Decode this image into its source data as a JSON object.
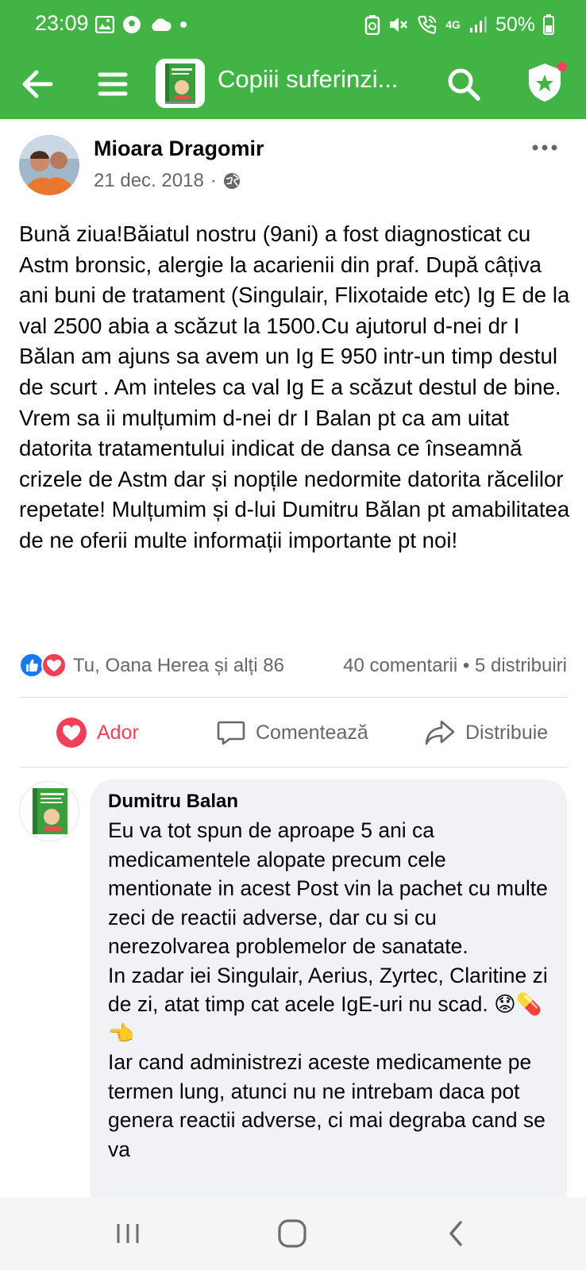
{
  "status_bar": {
    "time": "23:09",
    "battery": "50%",
    "network": "4G",
    "left_icons": [
      "image-icon",
      "soccer-ball-icon",
      "cloud-icon",
      "dot-icon"
    ],
    "right_icons": [
      "recycle-icon",
      "mute-icon",
      "wifi-call-icon",
      "signal-icon",
      "battery-icon"
    ]
  },
  "app_bar": {
    "title": "Copiii suferinzi...",
    "accent_color": "#42b445"
  },
  "post": {
    "author": "Mioara Dragomir",
    "date": "21 dec. 2018",
    "separator": "·",
    "privacy_icon": "globe-icon",
    "body": "Bună ziua!Băiatul nostru (9ani) a fost diagnosticat cu Astm bronsic, alergie la acarienii din praf. După câțiva ani buni de tratament (Singulair, Flixotaide etc)  Ig E de  la val 2500 abia a scăzut la 1500.Cu ajutorul d-nei dr I Bălan am ajuns sa avem un Ig E 950 intr-un timp destul de scurt . Am inteles ca val Ig E  a scăzut destul de bine. Vrem sa ii mulțumim d-nei dr I Balan pt ca am uitat datorita tratamentului indicat de dansa ce înseamnă crizele de Astm dar și nopțile nedormite datorita răcelilor repetate! Mulțumim și d-lui Dumitru Bălan pt amabilitatea de  ne oferii multe informații importante pt noi!",
    "reactions_names": "Tu, Oana Herea și alți 86",
    "reactions_stats": "40 comentarii • 5 distribuiri",
    "reaction_icons": [
      "like-icon",
      "love-icon"
    ]
  },
  "actions": {
    "love_label": "Ador",
    "comment_label": "Comentează",
    "share_label": "Distribuie",
    "love_color": "#f33e58"
  },
  "comment": {
    "author": "Dumitru Balan",
    "text": "Eu va tot spun de aproape 5 ani ca medicamentele alopate precum cele mentionate in acest Post vin la pachet cu multe zeci de reactii adverse, dar cu si cu nerezolvarea problemelor de sanatate.\nIn zadar iei Singulair, Aerius, Zyrtec, Claritine zi de zi, atat timp cat acele IgE-uri nu scad. 😟💊👈\nIar cand administrezi aceste medicamente pe termen lung, atunci nu ne intrebam daca pot genera reactii adverse, ci mai degraba cand se va"
  },
  "nav_bar": {
    "icons": [
      "recent-apps-icon",
      "home-icon",
      "back-nav-icon"
    ]
  }
}
